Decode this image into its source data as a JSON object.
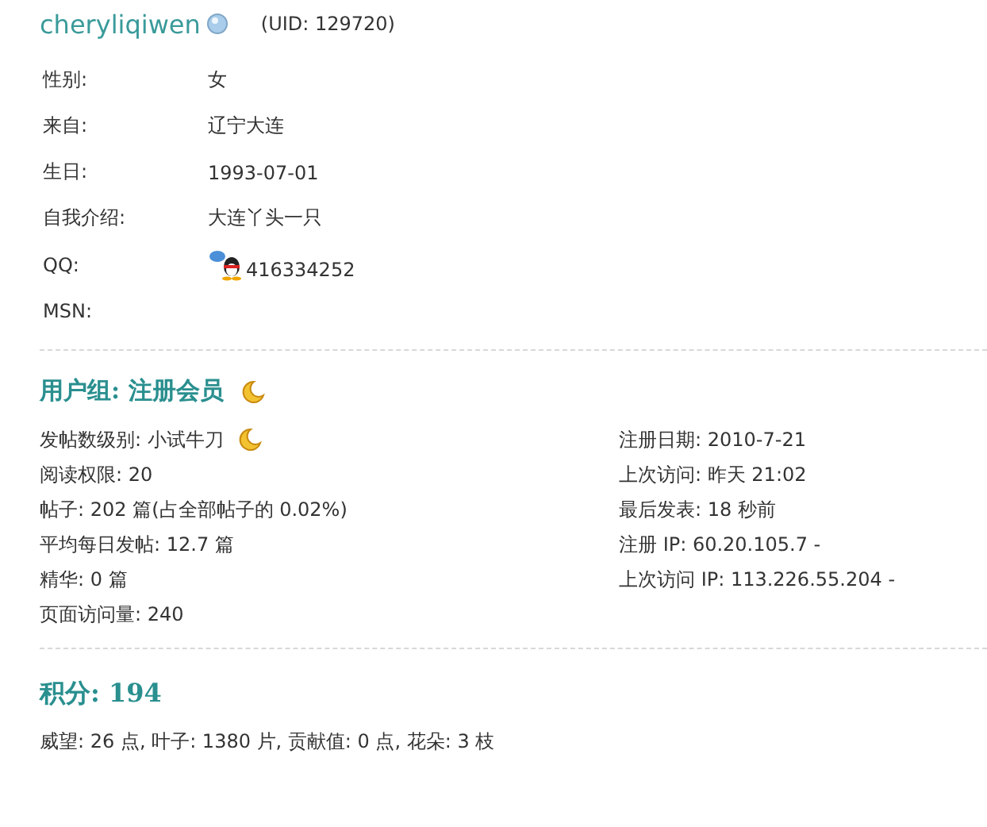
{
  "username": "cheryliqiwen",
  "uid": "(UID: 129720)",
  "profile": [
    {
      "label": "性别:",
      "value": "女",
      "kind": "text"
    },
    {
      "label": "来自:",
      "value": "辽宁大连",
      "kind": "text"
    },
    {
      "label": "生日:",
      "value": "1993-07-01",
      "kind": "text"
    },
    {
      "label": "自我介绍:",
      "value": "大连丫头一只",
      "kind": "text"
    },
    {
      "label": "QQ:",
      "value": "416334252",
      "kind": "qq"
    },
    {
      "label": "MSN:",
      "kind": "text"
    }
  ],
  "group": {
    "title": "用户组: 注册会员"
  },
  "stats_left": [
    {
      "text": "发帖数级别: 小试牛刀",
      "kind": "rank"
    },
    {
      "text": "阅读权限: 20",
      "kind": "text"
    },
    {
      "text": "帖子: 202 篇(占全部帖子的  0.02%)",
      "kind": "text"
    },
    {
      "text": "平均每日发帖: 12.7 篇",
      "kind": "text"
    },
    {
      "text": "精华: 0 篇",
      "kind": "text"
    },
    {
      "text": "页面访问量: 240",
      "kind": "text"
    }
  ],
  "stats_right": [
    "注册日期: 2010-7-21",
    "上次访问: 昨天 21:02",
    "最后发表: 18 秒前",
    "注册  IP: 60.20.105.7 -",
    "上次访问  IP: 113.226.55.204 -"
  ],
  "credits": {
    "title": "积分: 194",
    "detail": "威望: 26 点, 叶子: 1380 片, 贡献值: 0 点, 花朵: 3 枝"
  }
}
